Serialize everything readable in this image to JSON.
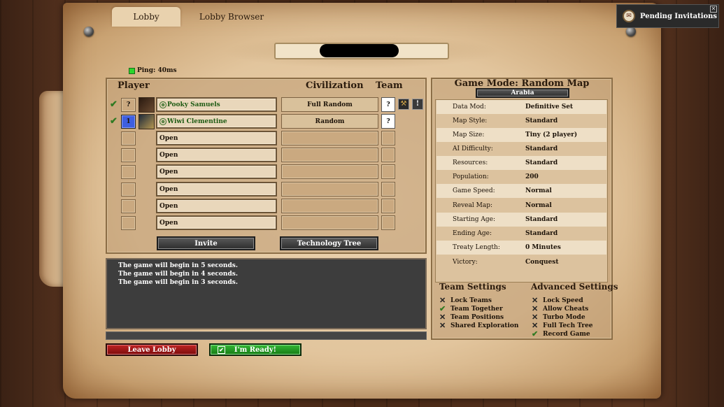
{
  "tabs": [
    {
      "label": "Lobby"
    },
    {
      "label": "Lobby Browser"
    }
  ],
  "notification": {
    "label": "Pending Invitations"
  },
  "ping": {
    "label": "Ping: 40ms",
    "status_color": "#2bd62b"
  },
  "players_table": {
    "headers": {
      "player": "Player",
      "civilization": "Civilization",
      "team": "Team"
    },
    "rows": [
      {
        "slot": "?",
        "name": "Pooky Samuels",
        "civilization": "Full Random",
        "team": "?"
      },
      {
        "slot": "1",
        "name": "Wiwi Clementine",
        "civilization": "Random",
        "team": "?"
      },
      {
        "name": "Open"
      },
      {
        "name": "Open"
      },
      {
        "name": "Open"
      },
      {
        "name": "Open"
      },
      {
        "name": "Open"
      },
      {
        "name": "Open"
      }
    ],
    "invite_label": "Invite",
    "tech_tree_label": "Technology Tree"
  },
  "chat": {
    "lines": [
      "The game will begin in 5 seconds.",
      "The game will begin in 4 seconds.",
      "The game will begin in 3 seconds."
    ]
  },
  "game_mode": {
    "title": "Game Mode: Random Map",
    "map": "Arabia",
    "settings": [
      {
        "key": "Data Mod:",
        "value": "Definitive Set"
      },
      {
        "key": "Map Style:",
        "value": "Standard"
      },
      {
        "key": "Map Size:",
        "value": "Tiny (2 player)"
      },
      {
        "key": "AI Difficulty:",
        "value": "Standard"
      },
      {
        "key": "Resources:",
        "value": "Standard"
      },
      {
        "key": "Population:",
        "value": "200"
      },
      {
        "key": "Game Speed:",
        "value": "Normal"
      },
      {
        "key": "Reveal Map:",
        "value": "Normal"
      },
      {
        "key": "Starting Age:",
        "value": "Standard"
      },
      {
        "key": "Ending Age:",
        "value": "Standard"
      },
      {
        "key": "Treaty Length:",
        "value": "0 Minutes"
      },
      {
        "key": "Victory:",
        "value": "Conquest"
      }
    ]
  },
  "team_settings": {
    "title": "Team Settings",
    "options": [
      {
        "label": "Lock Teams",
        "checked": false
      },
      {
        "label": "Team Together",
        "checked": true
      },
      {
        "label": "Team Positions",
        "checked": false
      },
      {
        "label": "Shared Exploration",
        "checked": false
      }
    ]
  },
  "advanced_settings": {
    "title": "Advanced Settings",
    "options": [
      {
        "label": "Lock Speed",
        "checked": false
      },
      {
        "label": "Allow Cheats",
        "checked": false
      },
      {
        "label": "Turbo Mode",
        "checked": false
      },
      {
        "label": "Full Tech Tree",
        "checked": false
      },
      {
        "label": "Record Game",
        "checked": true
      }
    ]
  },
  "footer": {
    "leave_label": "Leave Lobby",
    "ready_label": "I'm Ready!"
  },
  "colors": {
    "leave": "#a01818",
    "ready": "#1f9a1f",
    "player_slot_blue": "#3f5fe0",
    "check_green": "#2f7a22"
  },
  "icons": {
    "check": "✔",
    "cross": "✕",
    "globe": "globe-icon",
    "bell": "bell-icon"
  }
}
